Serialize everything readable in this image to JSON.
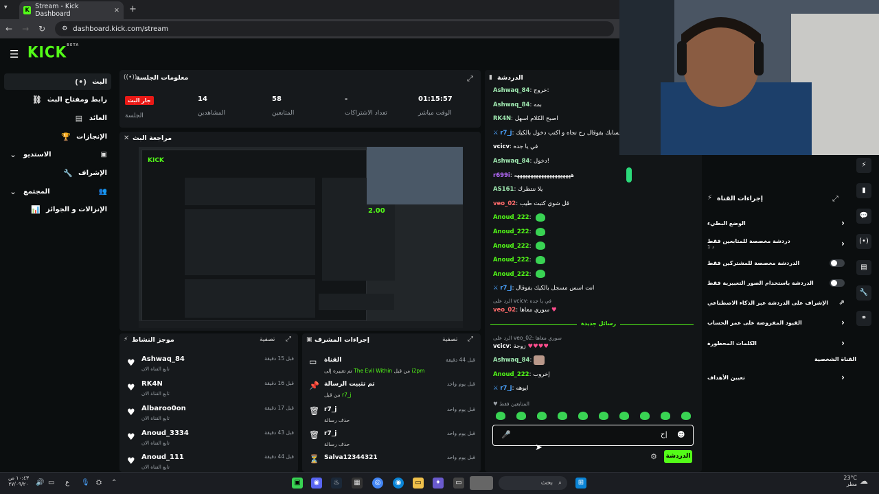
{
  "browser": {
    "tab_title": "Stream - Kick Dashboard",
    "url": "dashboard.kick.com/stream"
  },
  "app": {
    "logo": "KICK",
    "logo_badge": "BETA"
  },
  "sidebar": {
    "items": [
      {
        "label": "البث",
        "icon": "live-icon"
      },
      {
        "label": "رابط ومفتاح البث",
        "icon": "link-icon"
      },
      {
        "label": "العائد",
        "icon": "revenue-icon"
      },
      {
        "label": "الإنجازات",
        "icon": "trophy-icon"
      },
      {
        "label": "الاستديو",
        "icon": "studio-icon"
      },
      {
        "label": "الإشراف",
        "icon": "moderation-icon"
      },
      {
        "label": "المجتمع",
        "icon": "community-icon"
      },
      {
        "label": "الإنزالات و الجوائز",
        "icon": "drops-icon"
      }
    ]
  },
  "session": {
    "title": "معلومات الجلسة",
    "live_badge": "جار البث",
    "live_label": "الجلسة",
    "viewers_value": "14",
    "viewers_label": "المشاهدين",
    "followers_value": "58",
    "followers_label": "المتابعين",
    "subs_value": "-",
    "subs_label": "تعداد الاشتراكات",
    "uptime_value": "01:15:57",
    "uptime_label": "الوقت مباشر"
  },
  "preview": {
    "title": "مراجعة البث",
    "nested_number": "2.00"
  },
  "activity": {
    "title": "موجز النشاط",
    "filter": "تصفية",
    "items": [
      {
        "name": "Ashwaq_84",
        "sub": "تابع القناة الان",
        "time": "قبل 15 دقيقة"
      },
      {
        "name": "RK4N",
        "sub": "تابع القناة الان",
        "time": "قبل 16 دقيقة"
      },
      {
        "name": "Albaroo0on",
        "sub": "تابع القناة الان",
        "time": "قبل 17 دقيقة"
      },
      {
        "name": "Anoud_3334",
        "sub": "تابع القناة الان",
        "time": "قبل 43 دقيقة"
      },
      {
        "name": "Anoud_111",
        "sub": "تابع القناة الان",
        "time": "قبل 44 دقيقة"
      }
    ]
  },
  "mod": {
    "title": "إجراءات المشرف",
    "filter": "تصفية",
    "items": [
      {
        "name": "القناة",
        "sub_pre": "تم تغييره إلى",
        "game": "The Evil Within",
        "sub_post": "من قبل",
        "by": "i2pm",
        "time": "قبل 44 دقيقة",
        "icon": "channel-icon"
      },
      {
        "name": "تم تثبيت الرسالة",
        "sub_pre": "من قبل",
        "game": "",
        "sub_post": "",
        "by": "r7_j",
        "time": "قبل يوم واحد",
        "icon": "pin-icon"
      },
      {
        "name": "r7_j",
        "sub_pre": "حذف رسالة",
        "game": "",
        "sub_post": "",
        "by": "",
        "time": "قبل يوم واحد",
        "icon": "trash-icon"
      },
      {
        "name": "r7_j",
        "sub_pre": "حذف رسالة",
        "game": "",
        "sub_post": "",
        "by": "",
        "time": "قبل يوم واحد",
        "icon": "trash-icon"
      },
      {
        "name": "Salva12344321",
        "sub_pre": "",
        "game": "",
        "sub_post": "",
        "by": "",
        "time": "قبل يوم واحد",
        "icon": "hourglass-icon"
      }
    ]
  },
  "chat": {
    "title": "الدردشة",
    "lines": [
      {
        "user": "Ashwaq_84",
        "color": "#9fe8b0",
        "text": "خروج:",
        "emote": false
      },
      {
        "user": "Ashwaq_84",
        "color": "#9fe8b0",
        "text": "بمه",
        "emote": false
      },
      {
        "user": "RK4N",
        "color": "#9fe8b0",
        "text": "اصبح الكلام اسهل",
        "emote": false
      },
      {
        "user": "r7_j",
        "color": "#4aa3ff",
        "text": "مسجل حسابك بفوقال رح تجاه و اكتب دخول بالكيك",
        "emote": false
      },
      {
        "user": "vcicv",
        "color": "#ffffff",
        "text": "في يا جده",
        "emote": false
      },
      {
        "user": "Ashwaq_84",
        "color": "#9fe8b0",
        "text": "دخول!",
        "emote": false
      },
      {
        "user": "r699i",
        "color": "#b76bff",
        "text": "هههههههههههههههههههههه",
        "emote": false
      },
      {
        "user": "AS161",
        "color": "#9fe8b0",
        "text": "يلا ننتظرك",
        "emote": false
      },
      {
        "user": "veo_02",
        "color": "#ff6b6b",
        "text": "قل شوي كتبت طيب",
        "emote": false
      },
      {
        "user": "Anoud_222",
        "color": "#53fc18",
        "text": "",
        "emote": true
      },
      {
        "user": "Anoud_222",
        "color": "#53fc18",
        "text": "",
        "emote": true
      },
      {
        "user": "Anoud_222",
        "color": "#53fc18",
        "text": "",
        "emote": true
      },
      {
        "user": "Anoud_222",
        "color": "#53fc18",
        "text": "",
        "emote": true
      },
      {
        "user": "Anoud_222",
        "color": "#53fc18",
        "text": "",
        "emote": true
      },
      {
        "user": "r7_j",
        "color": "#4aa3ff",
        "text": "انت اسس مسجل بالكيك بفوقال",
        "emote": false
      }
    ],
    "reply_line": "الرد على vcicv: في يا جده",
    "reply_user": "veo_02",
    "reply_text": "سوري معاها",
    "new_messages": "رسائل جديدة",
    "reply2": "الرد على veo_02: سوري معاها",
    "lines2": [
      {
        "user": "vcicv",
        "color": "#ffffff",
        "text": "زوجة"
      },
      {
        "user": "Ashwaq_84",
        "color": "#9fe8b0",
        "text": ""
      },
      {
        "user": "Anoud_222",
        "color": "#53fc18",
        "text": "إخروب"
      },
      {
        "user": "r7_j",
        "color": "#4aa3ff",
        "text": "ايوهه"
      }
    ],
    "followers_only": "المتابعين فقط",
    "input_value": "ح|",
    "send_label": "الدردشة"
  },
  "actions": {
    "title": "إجراءات القناة",
    "rows": [
      {
        "label": "الوضع البطيء",
        "kind": "chevron"
      },
      {
        "label": "دردشة مخصصة للمتابعين فقط",
        "sub": "1 د",
        "kind": "chevron"
      },
      {
        "label": "الدردشة مخصصة للمشتركين فقط",
        "kind": "toggle"
      },
      {
        "label": "الدردشة باستخدام الصور التعبيرية فقط",
        "kind": "toggle"
      },
      {
        "label": "الإشراف على الدردشة عبر الذكاء الاصطناعي",
        "kind": "link"
      },
      {
        "label": "القيود المفروضة على عمر الحساب",
        "kind": "chevron"
      },
      {
        "label": "الكلمات المحظورة",
        "kind": "chevron"
      }
    ],
    "section_label": "القناة الشخصية",
    "goals": "تعيين الأهداف"
  },
  "taskbar": {
    "time": "١٠:٤٣ ص",
    "date": "٢٧/٠٩/٢٠",
    "lang": "ع",
    "search": "بحث",
    "weather_temp": "23°C",
    "weather_text": "مطر"
  },
  "colors": {
    "accent": "#53fc18",
    "live": "#e91916"
  }
}
